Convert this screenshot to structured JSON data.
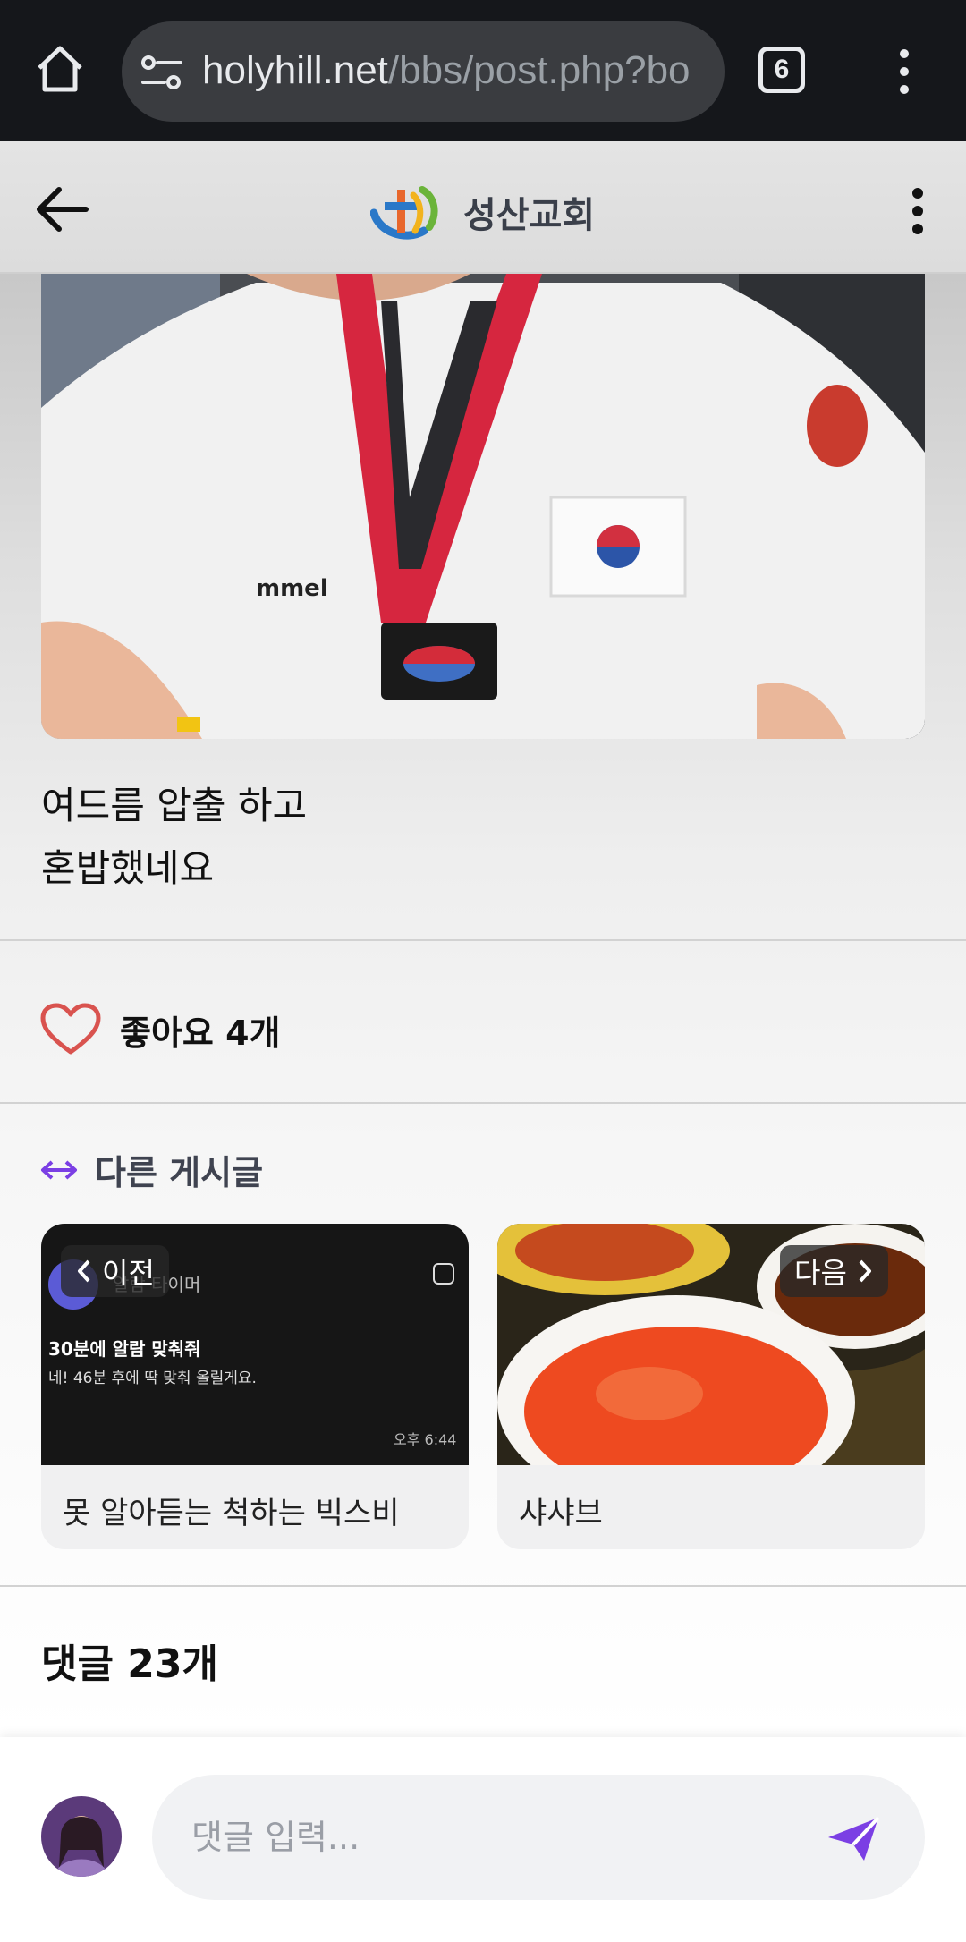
{
  "browser": {
    "url_domain": "holyhill.net",
    "url_path": "/bbs/post.php?bo",
    "tab_count": "6",
    "icons": [
      "home-icon",
      "site-info-icon",
      "tabs-icon",
      "more-vert-icon"
    ]
  },
  "header": {
    "site_name": "성산교회",
    "icons": [
      "back-arrow-icon",
      "church-logo-icon",
      "more-vert-icon"
    ]
  },
  "post": {
    "text_line1": "여드름 압출 하고",
    "text_line2": "혼밥했네요"
  },
  "likes": {
    "label": "좋아요 4개"
  },
  "other_posts": {
    "title": "다른 게시글",
    "prev": {
      "nav_label": "이전",
      "title": "못 알아듣는 척하는 빅스비",
      "thumb_line1": "30분에 알람 맞춰줘",
      "thumb_line2": "네! 46분 후에 딱 맞춰 올릴게요.",
      "thumb_time": "오후 6:44",
      "thumb_top": "알람 타이머"
    },
    "next": {
      "nav_label": "다음",
      "title": "샤샤브"
    }
  },
  "comments": {
    "title": "댓글 23개",
    "input_placeholder": "댓글 입력..."
  },
  "colors": {
    "accent_purple": "#7b3fe4",
    "heart_red": "#d9534f",
    "chrome_bg": "#15171b"
  }
}
